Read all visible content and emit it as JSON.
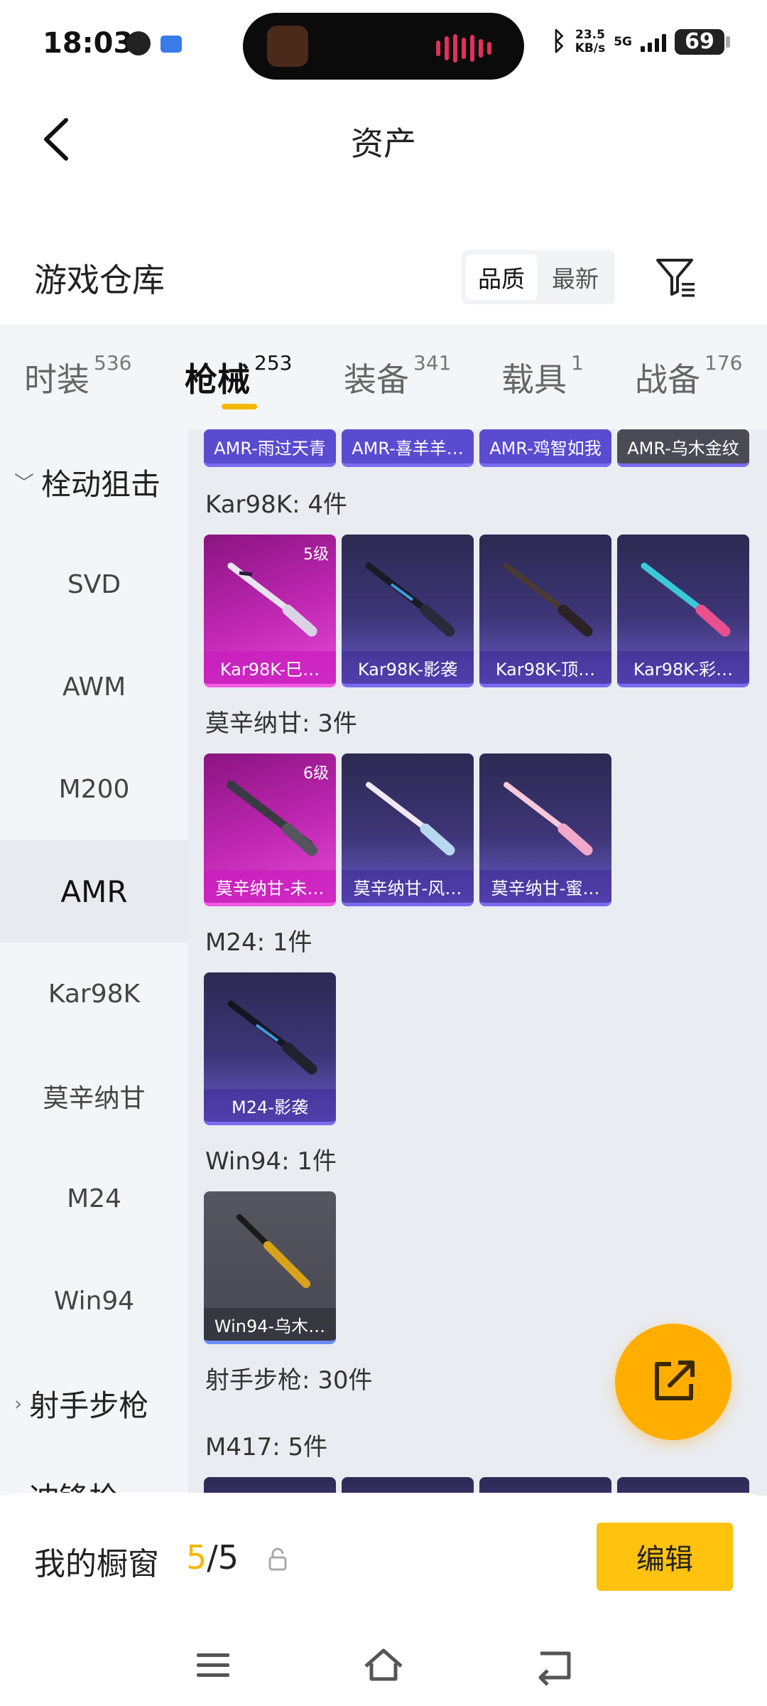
{
  "status_bar": {
    "time": "18:03",
    "speed_value": "23.5",
    "speed_unit": "KB/s",
    "network": "5G",
    "battery": "69",
    "icons": [
      "globe-icon",
      "message-icon",
      "bluetooth-icon",
      "signal-icon",
      "battery-icon"
    ]
  },
  "header": {
    "title": "资产",
    "back_icon": "chevron-left-icon"
  },
  "warehouse": {
    "title": "游戏仓库",
    "sort_options": [
      "品质",
      "最新"
    ],
    "active_sort": "品质",
    "filter_icon": "filter-icon"
  },
  "tabs": [
    {
      "label": "时装",
      "count": "536"
    },
    {
      "label": "枪械",
      "count": "253",
      "active": true
    },
    {
      "label": "装备",
      "count": "341"
    },
    {
      "label": "载具",
      "count": "1"
    },
    {
      "label": "战备",
      "count": "176"
    }
  ],
  "sidebar": {
    "group_bolt": "栓动狙击",
    "items": [
      "SVD",
      "AWM",
      "M200",
      "AMR",
      "Kar98K",
      "莫辛纳甘",
      "M24",
      "Win94"
    ],
    "active_item": "AMR",
    "group_marksman": "射手步枪",
    "group_partial": "冲锋枪"
  },
  "content": {
    "amr_cards": [
      "AMR-雨过天青",
      "AMR-喜羊羊…",
      "AMR-鸡智如我",
      "AMR-乌木金纹"
    ],
    "kar98k": {
      "title": "Kar98K: 4件",
      "cards": [
        {
          "label": "Kar98K-巳…",
          "level": "5级"
        },
        {
          "label": "Kar98K-影袭"
        },
        {
          "label": "Kar98K-顶…"
        },
        {
          "label": "Kar98K-彩…"
        }
      ]
    },
    "mosin": {
      "title": "莫辛纳甘: 3件",
      "cards": [
        {
          "label": "莫辛纳甘-未…",
          "level": "6级"
        },
        {
          "label": "莫辛纳甘-风…"
        },
        {
          "label": "莫辛纳甘-蜜…"
        }
      ]
    },
    "m24": {
      "title": "M24: 1件",
      "cards": [
        {
          "label": "M24-影袭"
        }
      ]
    },
    "win94": {
      "title": "Win94: 1件",
      "cards": [
        {
          "label": "Win94-乌木…"
        }
      ]
    },
    "marksman_title": "射手步枪: 30件",
    "m417_title": "M417: 5件"
  },
  "fab": {
    "icon": "share-icon"
  },
  "showcase": {
    "label": "我的橱窗",
    "current": "5",
    "total": "/5",
    "lock_icon": "lock-icon"
  },
  "edit_button": "编辑",
  "nav": {
    "icons": [
      "menu-icon",
      "home-icon",
      "back-icon"
    ]
  },
  "colors": {
    "accent": "#f5b800",
    "fab": "#ffae00",
    "edit": "#ffc20e",
    "quality_purple": "#6a5cc8",
    "quality_pink": "#e44bd5"
  }
}
